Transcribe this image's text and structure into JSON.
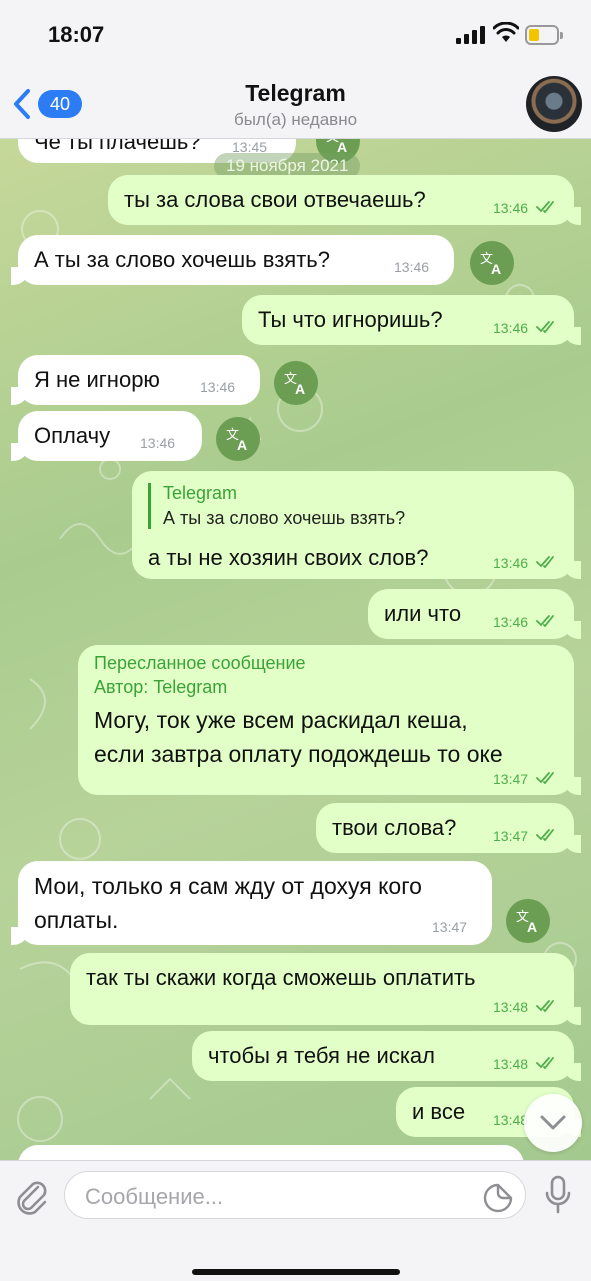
{
  "status_bar": {
    "time": "18:07"
  },
  "header": {
    "back_count": "40",
    "title": "Telegram",
    "subtitle": "был(а) недавно"
  },
  "chat": {
    "date_pill": "19 ноября 2021",
    "messages": [
      {
        "dir": "in",
        "text": "Че ты плачешь?",
        "time": "13:45"
      },
      {
        "dir": "out",
        "text": "ты за слова свои отвечаешь?",
        "time": "13:46"
      },
      {
        "dir": "in",
        "text": "А ты за слово хочешь взять?",
        "time": "13:46"
      },
      {
        "dir": "out",
        "text": "Ты что игноришь?",
        "time": "13:46"
      },
      {
        "dir": "in",
        "text": "Я не игнорю",
        "time": "13:46"
      },
      {
        "dir": "in",
        "text": "Оплачу",
        "time": "13:46"
      },
      {
        "dir": "out",
        "reply_name": "Telegram",
        "reply_text": "А ты за слово хочешь взять?",
        "text": "а ты не хозяин своих слов?",
        "time": "13:46"
      },
      {
        "dir": "out",
        "text": "или что",
        "time": "13:46"
      },
      {
        "dir": "out",
        "forward_header": "Пересланное сообщение",
        "forward_author": "Автор: Telegram",
        "text_line1": "Могу, ток уже всем раскидал кеша,",
        "text_line2": "если завтра оплату подождешь то оке",
        "time": "13:47"
      },
      {
        "dir": "out",
        "text": "твои слова?",
        "time": "13:47"
      },
      {
        "dir": "in",
        "text_line1": "Мои, только я сам жду от дохуя кого",
        "text_line2": "оплаты.",
        "time": "13:47"
      },
      {
        "dir": "out",
        "text": "так ты скажи когда сможешь оплатить",
        "time": "13:48"
      },
      {
        "dir": "out",
        "text": "чтобы я тебя не искал",
        "time": "13:48"
      },
      {
        "dir": "out",
        "text": "и все",
        "time": "13:48"
      }
    ]
  },
  "composer": {
    "placeholder": "Сообщение..."
  },
  "icons": {
    "back": "chevron-left-icon",
    "translate": "translate-icon",
    "read": "double-check-icon",
    "scroll": "chevron-down-icon",
    "attach": "paperclip-icon",
    "sticker": "sticker-icon",
    "mic": "microphone-icon"
  },
  "colors": {
    "accent": "#2c7cf6",
    "outgoing_bubble": "#e2ffc7",
    "incoming_bubble": "#ffffff",
    "time_out": "#4dae4a",
    "translate_button": "#6b9e52"
  }
}
